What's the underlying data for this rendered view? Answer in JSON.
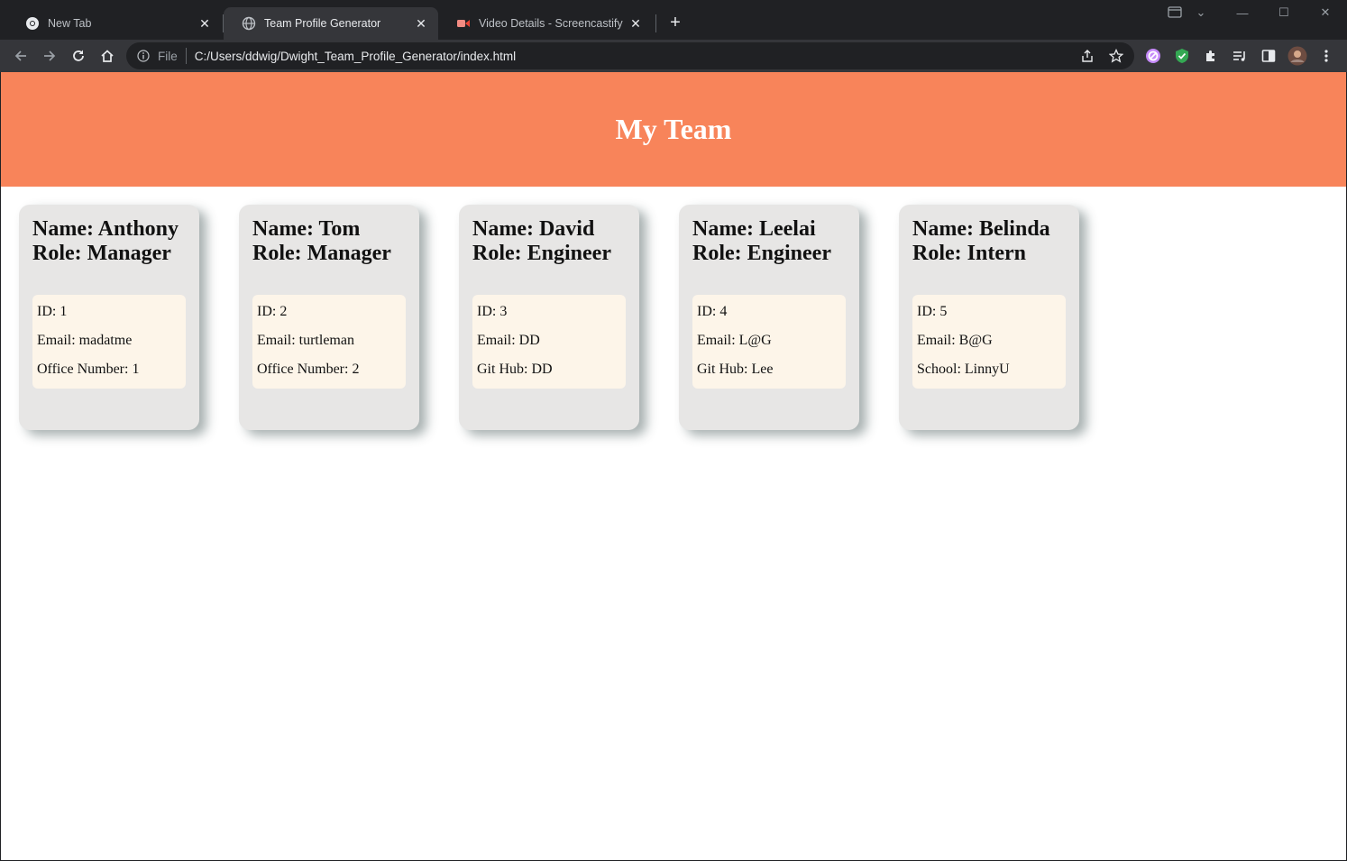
{
  "browser": {
    "tabs": [
      {
        "title": "New Tab",
        "icon": "chrome-icon",
        "active": false
      },
      {
        "title": "Team Profile Generator",
        "icon": "globe-icon",
        "active": true
      },
      {
        "title": "Video Details - Screencastify",
        "icon": "screencastify-icon",
        "active": false
      }
    ],
    "address": {
      "scheme_label": "File",
      "url": "C:/Users/ddwig/Dwight_Team_Profile_Generator/index.html"
    }
  },
  "page": {
    "heading": "My Team",
    "colors": {
      "banner": "#f8845a",
      "card": "#e7e6e5",
      "info_box": "#fdf5e9"
    },
    "cards": [
      {
        "name": "Name: Anthony",
        "role": "Role: Manager",
        "id": "ID: 1",
        "email": "Email: madatme",
        "extra": "Office Number: 1"
      },
      {
        "name": "Name: Tom",
        "role": "Role: Manager",
        "id": "ID: 2",
        "email": "Email: turtleman",
        "extra": "Office Number: 2"
      },
      {
        "name": "Name: David",
        "role": "Role: Engineer",
        "id": "ID: 3",
        "email": "Email: DD",
        "extra": "Git Hub: DD"
      },
      {
        "name": "Name: Leelai",
        "role": "Role: Engineer",
        "id": "ID: 4",
        "email": "Email: L@G",
        "extra": "Git Hub: Lee"
      },
      {
        "name": "Name: Belinda",
        "role": "Role: Intern",
        "id": "ID: 5",
        "email": "Email: B@G",
        "extra": "School: LinnyU"
      }
    ]
  }
}
